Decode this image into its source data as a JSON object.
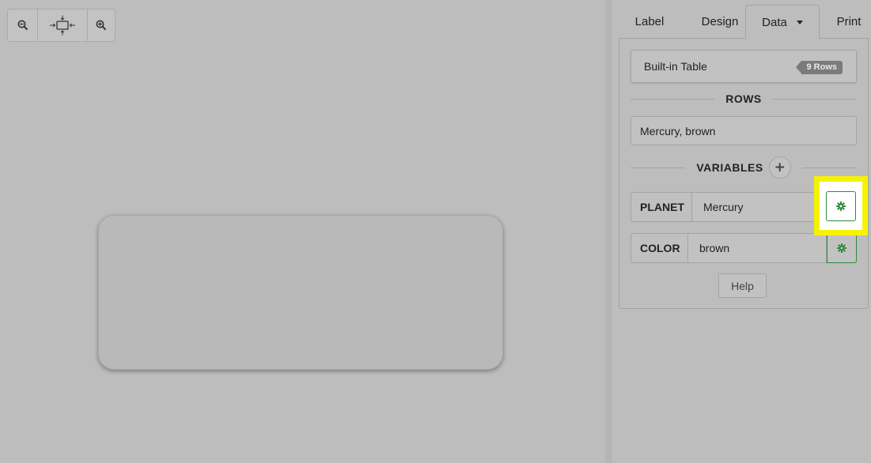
{
  "toolbar": {
    "zoom_out_icon": "zoom-out-icon",
    "fit_icon": "fit-to-screen-icon",
    "zoom_in_icon": "zoom-in-icon"
  },
  "tabs": {
    "label": "Label",
    "design": "Design",
    "data": "Data",
    "print": "Print",
    "active": "Data"
  },
  "data_panel": {
    "source_label": "Built-in Table",
    "rows_badge": "9 Rows",
    "rows_heading": "ROWS",
    "selected_row": "Mercury, brown",
    "variables_heading": "VARIABLES",
    "add_variable_icon": "plus-icon",
    "variables": [
      {
        "name": "PLANET",
        "value": "Mercury"
      },
      {
        "name": "COLOR",
        "value": "brown"
      }
    ],
    "help_label": "Help"
  },
  "colors": {
    "background": "#bdbdbd",
    "gear": "#2e8b3a",
    "highlight": "#f5f300"
  }
}
